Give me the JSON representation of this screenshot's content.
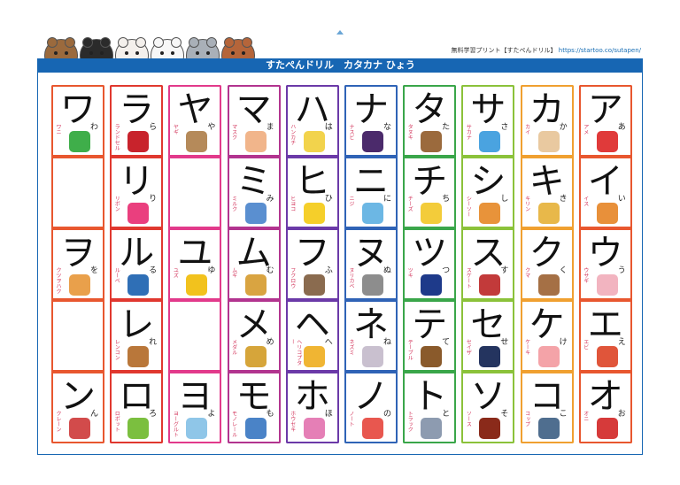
{
  "header": {
    "site_text": "無料学習プリント【すたぺんドリル】",
    "site_url": "https://startoo.co/sutapen/",
    "banner_title": "すたぺんドリル　カタカナ ひょう"
  },
  "animals": [
    "bear-icon",
    "black-bear-icon",
    "rabbit-icon",
    "panda-icon",
    "koala-icon",
    "red-panda-icon"
  ],
  "columns": [
    {
      "color": "#e8572f",
      "cells": [
        {
          "big": "ワ",
          "kana": "わ",
          "word": "ワニ",
          "pic": "#3fae4a"
        },
        {
          "big": "",
          "kana": "",
          "word": "",
          "pic": ""
        },
        {
          "big": "ヲ",
          "kana": "を",
          "word": "クツヲハク",
          "pic": "#e9a04b"
        },
        {
          "big": "",
          "kana": "",
          "word": "",
          "pic": ""
        },
        {
          "big": "ン",
          "kana": "ん",
          "word": "クレーン",
          "pic": "#d24b4b"
        }
      ]
    },
    {
      "color": "#e0382f",
      "cells": [
        {
          "big": "ラ",
          "kana": "ら",
          "word": "ランドセル",
          "pic": "#c8232c"
        },
        {
          "big": "リ",
          "kana": "り",
          "word": "リボン",
          "pic": "#ea3f7e"
        },
        {
          "big": "ル",
          "kana": "る",
          "word": "ルーペ",
          "pic": "#2f6fb6"
        },
        {
          "big": "レ",
          "kana": "れ",
          "word": "レンコン",
          "pic": "#b9773a"
        },
        {
          "big": "ロ",
          "kana": "ろ",
          "word": "ロボット",
          "pic": "#7bbf3f"
        }
      ]
    },
    {
      "color": "#e23a8b",
      "cells": [
        {
          "big": "ヤ",
          "kana": "や",
          "word": "ヤギ",
          "pic": "#b58a5a"
        },
        {
          "big": "",
          "kana": "",
          "word": "",
          "pic": ""
        },
        {
          "big": "ユ",
          "kana": "ゆ",
          "word": "ユズ",
          "pic": "#f2c21d"
        },
        {
          "big": "",
          "kana": "",
          "word": "",
          "pic": ""
        },
        {
          "big": "ヨ",
          "kana": "よ",
          "word": "ヨーグルト",
          "pic": "#8fc6e8"
        }
      ]
    },
    {
      "color": "#b2348f",
      "cells": [
        {
          "big": "マ",
          "kana": "ま",
          "word": "マスク",
          "pic": "#f1b58b"
        },
        {
          "big": "ミ",
          "kana": "み",
          "word": "ミルク",
          "pic": "#5a8fd0"
        },
        {
          "big": "ム",
          "kana": "む",
          "word": "ムギ",
          "pic": "#d9a441"
        },
        {
          "big": "メ",
          "kana": "め",
          "word": "メダル",
          "pic": "#d6a53a"
        },
        {
          "big": "モ",
          "kana": "も",
          "word": "モノレール",
          "pic": "#4a83c7"
        }
      ]
    },
    {
      "color": "#6b3aa8",
      "cells": [
        {
          "big": "ハ",
          "kana": "は",
          "word": "ハンカチ",
          "pic": "#f2d34c"
        },
        {
          "big": "ヒ",
          "kana": "ひ",
          "word": "ヒヨコ",
          "pic": "#f5cf2a"
        },
        {
          "big": "フ",
          "kana": "ふ",
          "word": "フクロウ",
          "pic": "#8a6b4f"
        },
        {
          "big": "ヘ",
          "kana": "へ",
          "word": "ヘリコプター",
          "pic": "#f0b533"
        },
        {
          "big": "ホ",
          "kana": "ほ",
          "word": "ホウセキ",
          "pic": "#e57fb6"
        }
      ]
    },
    {
      "color": "#2f63b6",
      "cells": [
        {
          "big": "ナ",
          "kana": "な",
          "word": "ナスビ",
          "pic": "#4b2a6b"
        },
        {
          "big": "ニ",
          "kana": "に",
          "word": "ニジ",
          "pic": "#6cb7e4"
        },
        {
          "big": "ヌ",
          "kana": "ぬ",
          "word": "ヌリカベ",
          "pic": "#8d8d8d"
        },
        {
          "big": "ネ",
          "kana": "ね",
          "word": "ネズミ",
          "pic": "#c9c0cf"
        },
        {
          "big": "ノ",
          "kana": "の",
          "word": "ノート",
          "pic": "#e8574f"
        }
      ]
    },
    {
      "color": "#3aa64a",
      "cells": [
        {
          "big": "タ",
          "kana": "た",
          "word": "タヌキ",
          "pic": "#9b6a3d"
        },
        {
          "big": "チ",
          "kana": "ち",
          "word": "チーズ",
          "pic": "#f3cc3a"
        },
        {
          "big": "ツ",
          "kana": "つ",
          "word": "ツキ",
          "pic": "#1e3a8a"
        },
        {
          "big": "テ",
          "kana": "て",
          "word": "テーブル",
          "pic": "#8a5a2b"
        },
        {
          "big": "ト",
          "kana": "と",
          "word": "トラック",
          "pic": "#8d9bb0"
        }
      ]
    },
    {
      "color": "#8bc23a",
      "cells": [
        {
          "big": "サ",
          "kana": "さ",
          "word": "サカナ",
          "pic": "#4aa3e0"
        },
        {
          "big": "シ",
          "kana": "し",
          "word": "シーソー",
          "pic": "#e8933a"
        },
        {
          "big": "ス",
          "kana": "す",
          "word": "スケート",
          "pic": "#c23a3a"
        },
        {
          "big": "セ",
          "kana": "せ",
          "word": "セイザ",
          "pic": "#24345f"
        },
        {
          "big": "ソ",
          "kana": "そ",
          "word": "ソース",
          "pic": "#8a2a1a"
        }
      ]
    },
    {
      "color": "#f0a030",
      "cells": [
        {
          "big": "カ",
          "kana": "か",
          "word": "カイ",
          "pic": "#e9c9a0"
        },
        {
          "big": "キ",
          "kana": "き",
          "word": "キリン",
          "pic": "#e8b84a"
        },
        {
          "big": "ク",
          "kana": "く",
          "word": "クマ",
          "pic": "#a57045"
        },
        {
          "big": "ケ",
          "kana": "け",
          "word": "ケーキ",
          "pic": "#f4a3a8"
        },
        {
          "big": "コ",
          "kana": "こ",
          "word": "コップ",
          "pic": "#4f6e8f"
        }
      ]
    },
    {
      "color": "#e8572f",
      "cells": [
        {
          "big": "ア",
          "kana": "あ",
          "word": "アメ",
          "pic": "#e03a3a"
        },
        {
          "big": "イ",
          "kana": "い",
          "word": "イス",
          "pic": "#e8903a"
        },
        {
          "big": "ウ",
          "kana": "う",
          "word": "ウサギ",
          "pic": "#f2b4c0"
        },
        {
          "big": "エ",
          "kana": "え",
          "word": "エビ",
          "pic": "#e0553a"
        },
        {
          "big": "オ",
          "kana": "お",
          "word": "オニ",
          "pic": "#d63a3a"
        }
      ]
    }
  ]
}
